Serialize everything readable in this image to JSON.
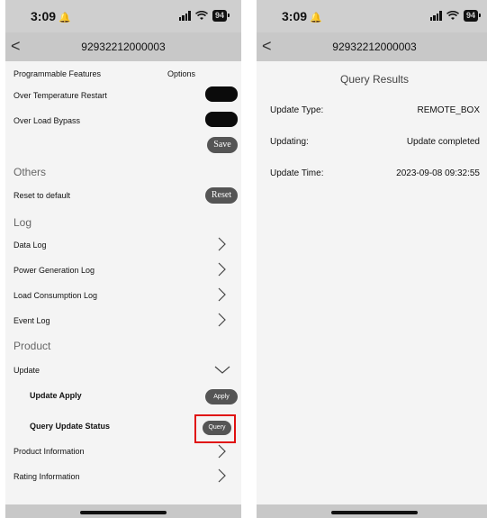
{
  "status_bar": {
    "time": "3:09",
    "battery": "94"
  },
  "left": {
    "nav_title": "92932212000003",
    "header": {
      "features_label": "Programmable Features",
      "options_label": "Options"
    },
    "features": [
      {
        "label": "Over Temperature Restart"
      },
      {
        "label": "Over Load Bypass"
      }
    ],
    "save_label": "Save",
    "others_title": "Others",
    "reset_row_label": "Reset to default",
    "reset_button": "Reset",
    "log_title": "Log",
    "log_items": [
      "Data Log",
      "Power Generation Log",
      "Load Consumption Log",
      "Event Log"
    ],
    "product_title": "Product",
    "update_label": "Update",
    "update_apply_label": "Update Apply",
    "apply_button": "Apply",
    "query_status_label": "Query Update Status",
    "query_button": "Query",
    "product_info_label": "Product Information",
    "rating_info_label": "Rating Information"
  },
  "right": {
    "nav_title": "92932212000003",
    "title": "Query Results",
    "results": [
      {
        "key": "Update Type:",
        "value": "REMOTE_BOX"
      },
      {
        "key": "Updating:",
        "value": "Update completed"
      },
      {
        "key": "Update Time:",
        "value": "2023-09-08 09:32:55"
      }
    ]
  }
}
